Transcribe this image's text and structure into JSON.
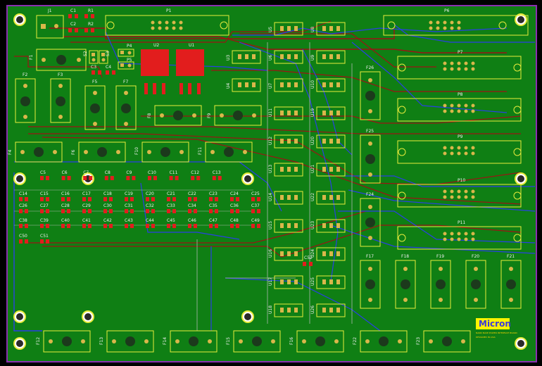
{
  "colors": {
    "board": "#0f7f14",
    "board_edge": "#8b2fb0",
    "silk": "#e8ec3c",
    "pad": "#e21d1d",
    "pad_gold": "#d9b74a",
    "trace_red": "#9c1414",
    "trace_blue": "#2a3fe6",
    "trace_gray": "#aeb7ae",
    "hole": "#b8b8b8"
  },
  "connectors": {
    "P1": "P1",
    "P6": "P6",
    "P7": "P7",
    "P8": "P8",
    "P9": "P9",
    "P10": "P10",
    "P11": "P11",
    "P4": "P4",
    "P5": "P5",
    "J1": "J1"
  },
  "regulators": {
    "U1": "U1",
    "U2": "U2"
  },
  "misc_labels": {
    "R1": "R1",
    "R2": "R2",
    "C1": "C1",
    "C2": "C2",
    "C3": "C3",
    "C4": "C4",
    "S2": "S2",
    "S3": "S3",
    "C52": "C52"
  },
  "column_u": [
    [
      "U5",
      "U8"
    ],
    [
      "U6",
      "U9"
    ],
    [
      "U7",
      "U10"
    ],
    [
      "U11",
      "U19"
    ],
    [
      "U12",
      "U20"
    ],
    [
      "U13",
      "U21"
    ],
    [
      "U14",
      "U22"
    ],
    [
      "U15",
      "U23"
    ],
    [
      "U16",
      "U24"
    ],
    [
      "U17",
      "U25"
    ],
    [
      "U18",
      "U26"
    ]
  ],
  "extra_u": [
    "U3",
    "U4"
  ],
  "fuses_vertical": [
    "F2",
    "F3",
    "F5",
    "F7",
    "F26",
    "F25",
    "F24",
    "F17",
    "F18",
    "F19",
    "F20",
    "F21"
  ],
  "fuses_horizontal": [
    "F1",
    "F8",
    "F9",
    "F4",
    "F6",
    "F10",
    "F11"
  ],
  "fuses_bottom": [
    "F12",
    "F13",
    "F14",
    "F15",
    "F16",
    "F22",
    "F23"
  ],
  "cap_rows": [
    [
      "C5",
      "C6",
      "C7",
      "C8",
      "C9",
      "C10",
      "C11",
      "C12",
      "C13"
    ],
    [
      "C14",
      "C15",
      "C16",
      "C17",
      "C18",
      "C19",
      "C20",
      "C21",
      "C22",
      "C23",
      "C24",
      "C25"
    ],
    [
      "C26",
      "C27",
      "C28",
      "C29",
      "C30",
      "C31",
      "C32",
      "C33",
      "C34",
      "C35",
      "C36",
      "C37"
    ],
    [
      "C38",
      "C39",
      "C40",
      "C41",
      "C42",
      "C43",
      "C44",
      "C45",
      "C46",
      "C47",
      "C48",
      "C49"
    ],
    [
      "C50",
      "C51"
    ]
  ],
  "logo": {
    "brand": "Micron",
    "line1": "NAND BASE POWER INTERFACE BOARD",
    "line2": "DESIGNED IN ASIA"
  }
}
